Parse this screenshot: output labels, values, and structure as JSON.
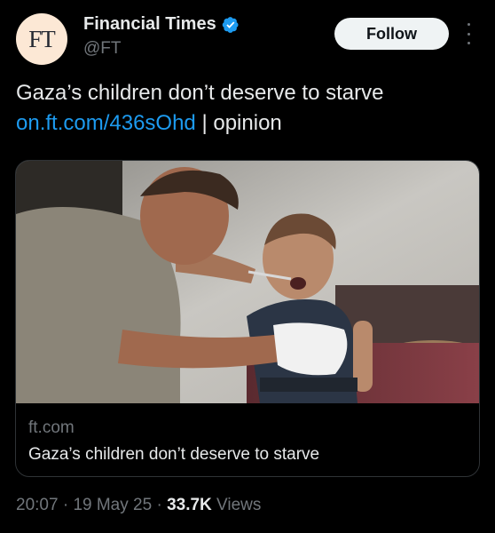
{
  "author": {
    "avatar_text": "FT",
    "name": "Financial Times",
    "handle": "@FT",
    "verified_icon": "verified-badge-icon"
  },
  "follow_label": "Follow",
  "post": {
    "line1": "Gaza’s children don’t deserve to starve",
    "link": "on.ft.com/436sOhd",
    "suffix": "| opinion"
  },
  "card": {
    "image_icon": "photo-image",
    "domain": "ft.com",
    "title": "Gaza’s children don’t deserve to starve"
  },
  "meta": {
    "time": "20:07",
    "sep1": " · ",
    "date": "19 May 25",
    "sep2": " · ",
    "views_count": "33.7K",
    "views_label": " Views"
  },
  "colors": {
    "background": "#000000",
    "text": "#e7e9ea",
    "muted": "#71767b",
    "link": "#1d9bf0",
    "avatar_bg": "#fce8d5"
  }
}
